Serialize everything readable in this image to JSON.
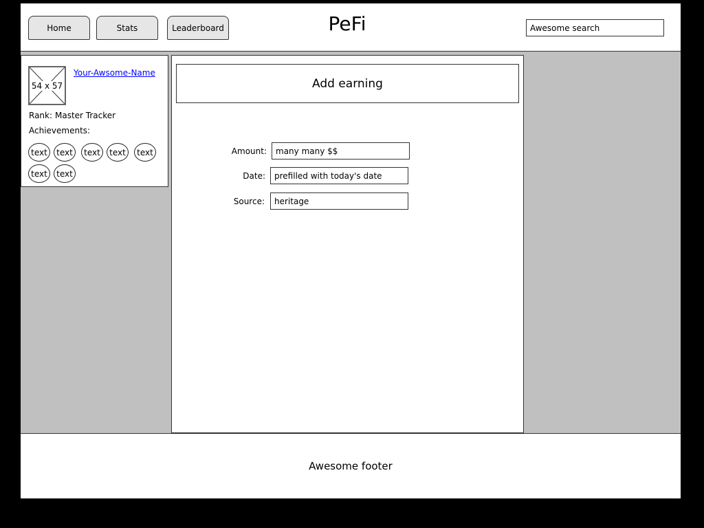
{
  "header": {
    "tabs": [
      {
        "label": "Home"
      },
      {
        "label": "Stats"
      },
      {
        "label": "Leaderboard"
      }
    ],
    "title": "PeFi",
    "search_value": "Awesome search"
  },
  "profile": {
    "avatar_placeholder": "54 x 57",
    "name": "Your-Awsome-Name",
    "rank_label": "Rank:",
    "rank_value": "Master Tracker",
    "achievements_label": "Achievements:",
    "achievements": [
      "text",
      "text",
      "text",
      "text",
      "text",
      "text",
      "text"
    ]
  },
  "main": {
    "heading": "Add earning",
    "form": {
      "amount_label": "Amount:",
      "amount_value": "many many $$",
      "date_label": "Date:",
      "date_value": "prefilled with today's date",
      "source_label": "Source:",
      "source_value": "heritage"
    }
  },
  "footer": {
    "text": "Awesome footer"
  }
}
